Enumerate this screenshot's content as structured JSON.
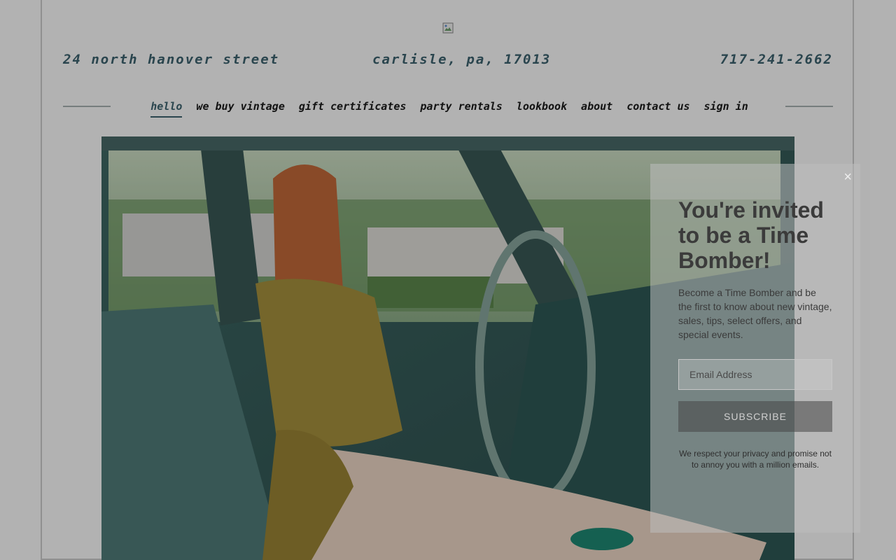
{
  "header": {
    "address": "24 North Hanover Street",
    "city": "Carlisle, PA, 17013",
    "phone": "717-241-2662"
  },
  "nav": {
    "items": [
      {
        "label": "Hello",
        "active": true
      },
      {
        "label": "We Buy Vintage",
        "active": false
      },
      {
        "label": "Gift Certificates",
        "active": false
      },
      {
        "label": "Party Rentals",
        "active": false
      },
      {
        "label": "Lookbook",
        "active": false
      },
      {
        "label": "About",
        "active": false
      },
      {
        "label": "Contact Us",
        "active": false
      },
      {
        "label": "Sign In",
        "active": false
      }
    ]
  },
  "modal": {
    "close_symbol": "×",
    "title": "You're invited to be a Time Bomber!",
    "description": "Become a Time Bomber and be the first to know about new vintage, sales, tips, select offers, and special events.",
    "email_placeholder": "Email Address",
    "subscribe_label": "SUBSCRIBE",
    "privacy_note": "We respect your privacy and promise not to annoy you with a million emails."
  },
  "colors": {
    "accent": "#3d6470",
    "nav_text": "#1a1a1a",
    "overlay": "rgba(0,0,0,0.30)"
  },
  "icons": {
    "logo": "broken-image-icon",
    "close": "close-icon"
  }
}
